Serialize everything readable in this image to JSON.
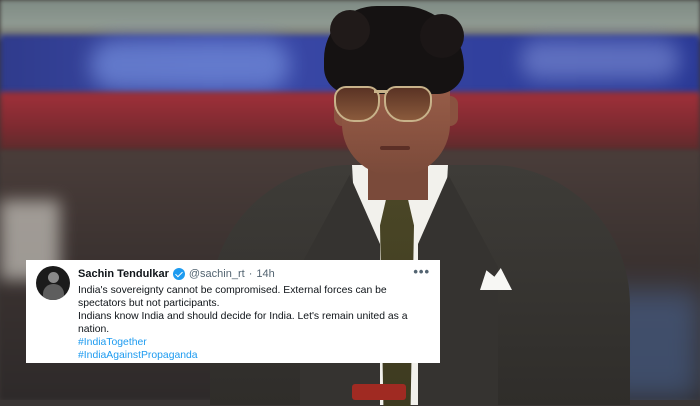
{
  "tweet": {
    "author_name": "Sachin Tendulkar",
    "handle": "@sachin_rt",
    "separator": "·",
    "time": "14h",
    "more_label": "•••",
    "lines": [
      "India's sovereignty cannot be compromised. External forces can be",
      "spectators but not participants.",
      "Indians know India and should decide for India. Let's remain united as a",
      "nation."
    ],
    "hashtags": [
      "#IndiaTogether",
      "#IndiaAgainstPropaganda"
    ]
  },
  "icons": {
    "verified": "verified-badge-icon",
    "more": "more-options-icon"
  },
  "colors": {
    "hashtag": "#1d9bf0",
    "verified": "#1d9bf0",
    "text": "#0f1419",
    "muted": "#536471"
  }
}
